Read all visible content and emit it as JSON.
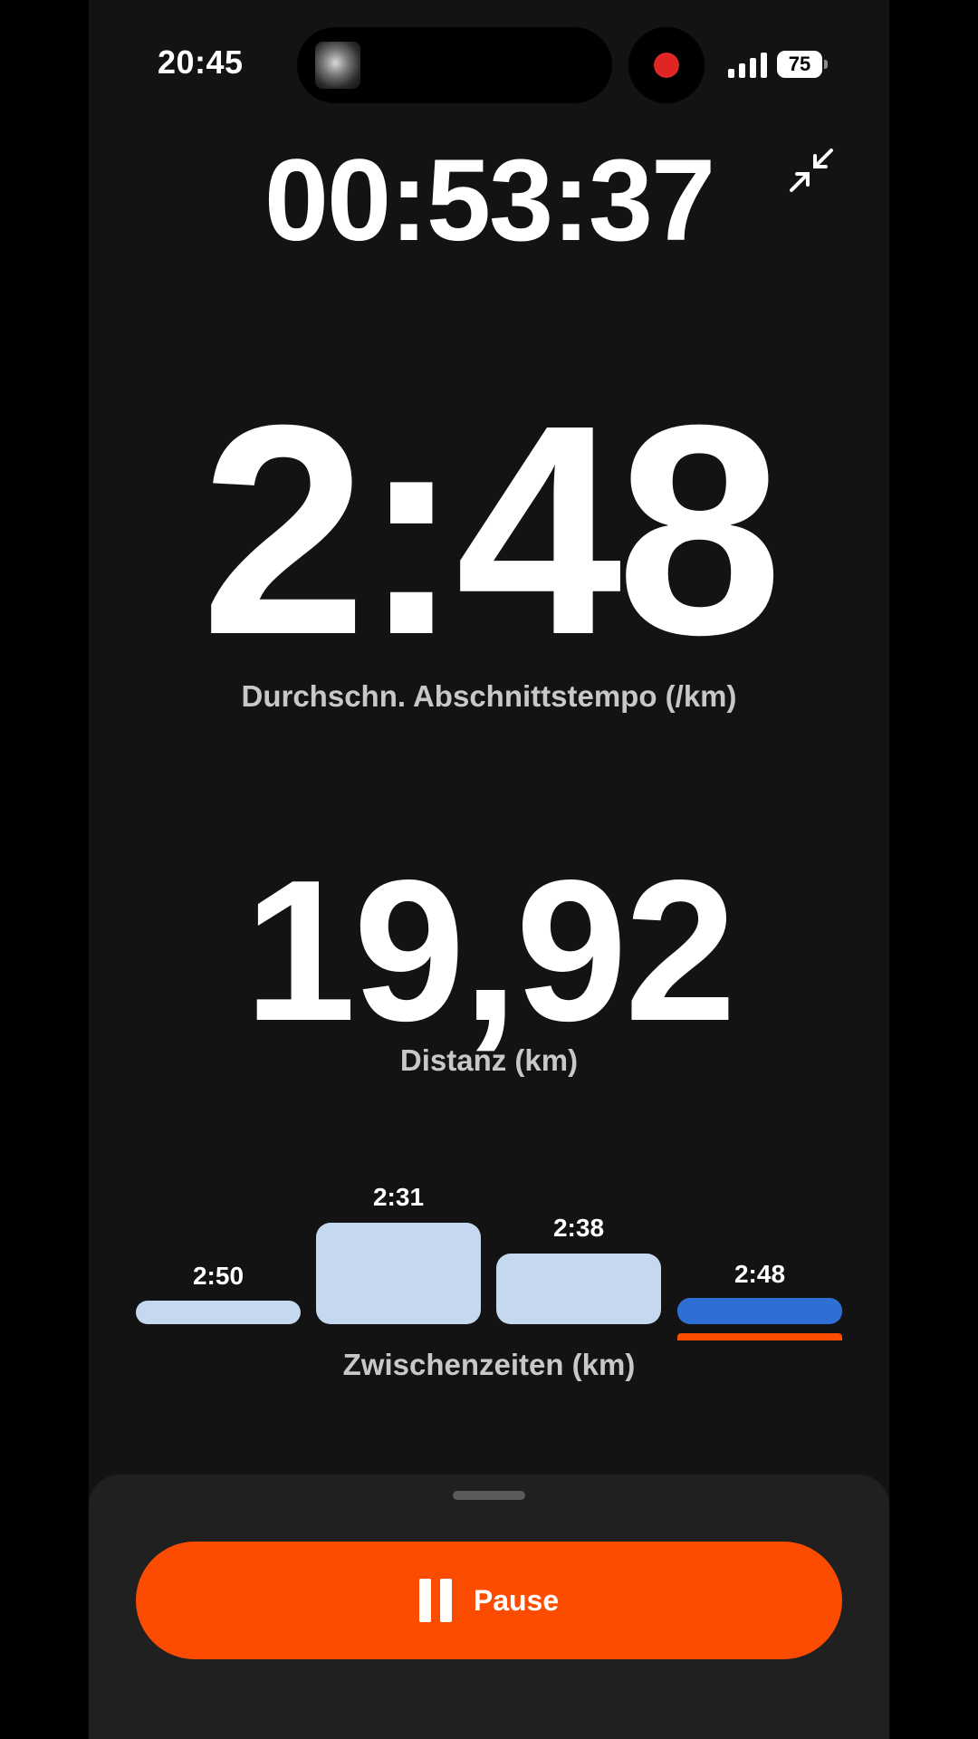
{
  "status_bar": {
    "time": "20:45",
    "battery_level": "75",
    "recording": true,
    "icons": [
      "now-playing-thumbnail",
      "recording-dot-icon",
      "signal-icon",
      "battery-icon"
    ]
  },
  "workout": {
    "elapsed_time": "00:53:37",
    "collapse_icon": "collapse-arrows-icon"
  },
  "metrics": {
    "pace": {
      "value": "2:48",
      "label": "Durchschn. Abschnittstempo (/km)"
    },
    "distance": {
      "value": "19,92",
      "label": "Distanz (km)"
    }
  },
  "splits": {
    "label": "Zwischenzeiten (km)",
    "items": [
      {
        "label": "2:50",
        "current": false
      },
      {
        "label": "2:31",
        "current": false
      },
      {
        "label": "2:38",
        "current": false
      },
      {
        "label": "2:48",
        "current": true
      }
    ]
  },
  "controls": {
    "pause_label": "Pause"
  },
  "colors": {
    "accent": "#fc4c02",
    "split_bar": "#c5d8f0",
    "current_split": "#2e6fd4",
    "background": "#131313"
  }
}
